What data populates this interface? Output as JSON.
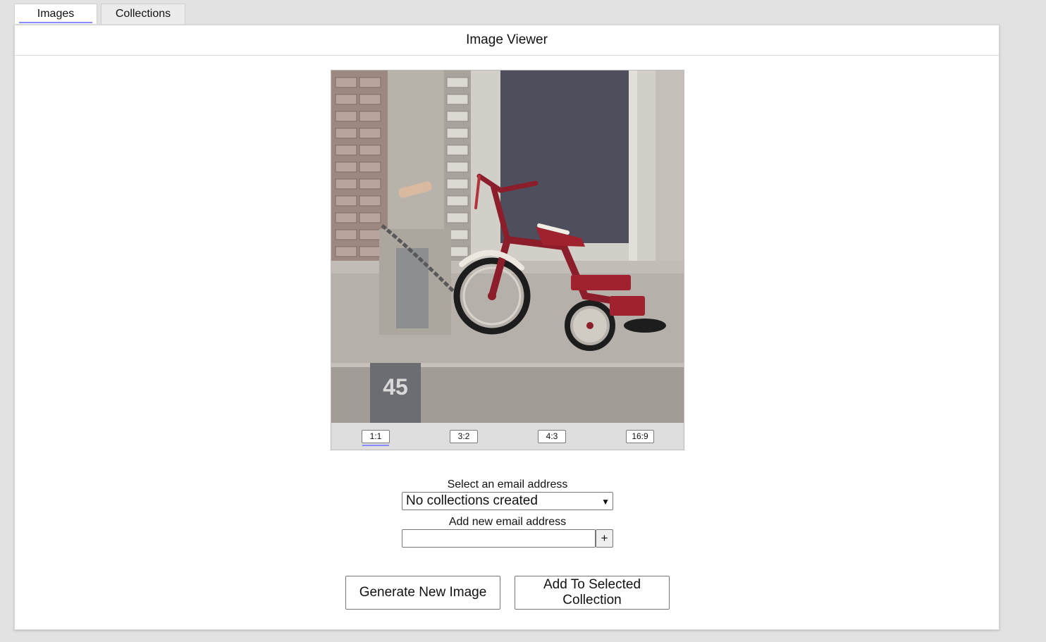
{
  "tabs": [
    {
      "label": "Images",
      "active": true
    },
    {
      "label": "Collections",
      "active": false
    }
  ],
  "header": {
    "title": "Image Viewer"
  },
  "viewer": {
    "image_description_icon": "tricycle-photo",
    "curb_number": "45",
    "ratios": [
      "1:1",
      "3:2",
      "4:3",
      "16:9"
    ],
    "selected_ratio": "1:1"
  },
  "form": {
    "select_label": "Select an email address",
    "select_value": "No collections created",
    "add_label": "Add new email address",
    "add_input_value": "",
    "add_button_label": "+"
  },
  "actions": {
    "generate_label": "Generate New Image",
    "add_label": "Add To Selected Collection"
  },
  "colors": {
    "accent": "#8a8aff",
    "background": "#e2e2e2",
    "panel": "#ffffff"
  }
}
